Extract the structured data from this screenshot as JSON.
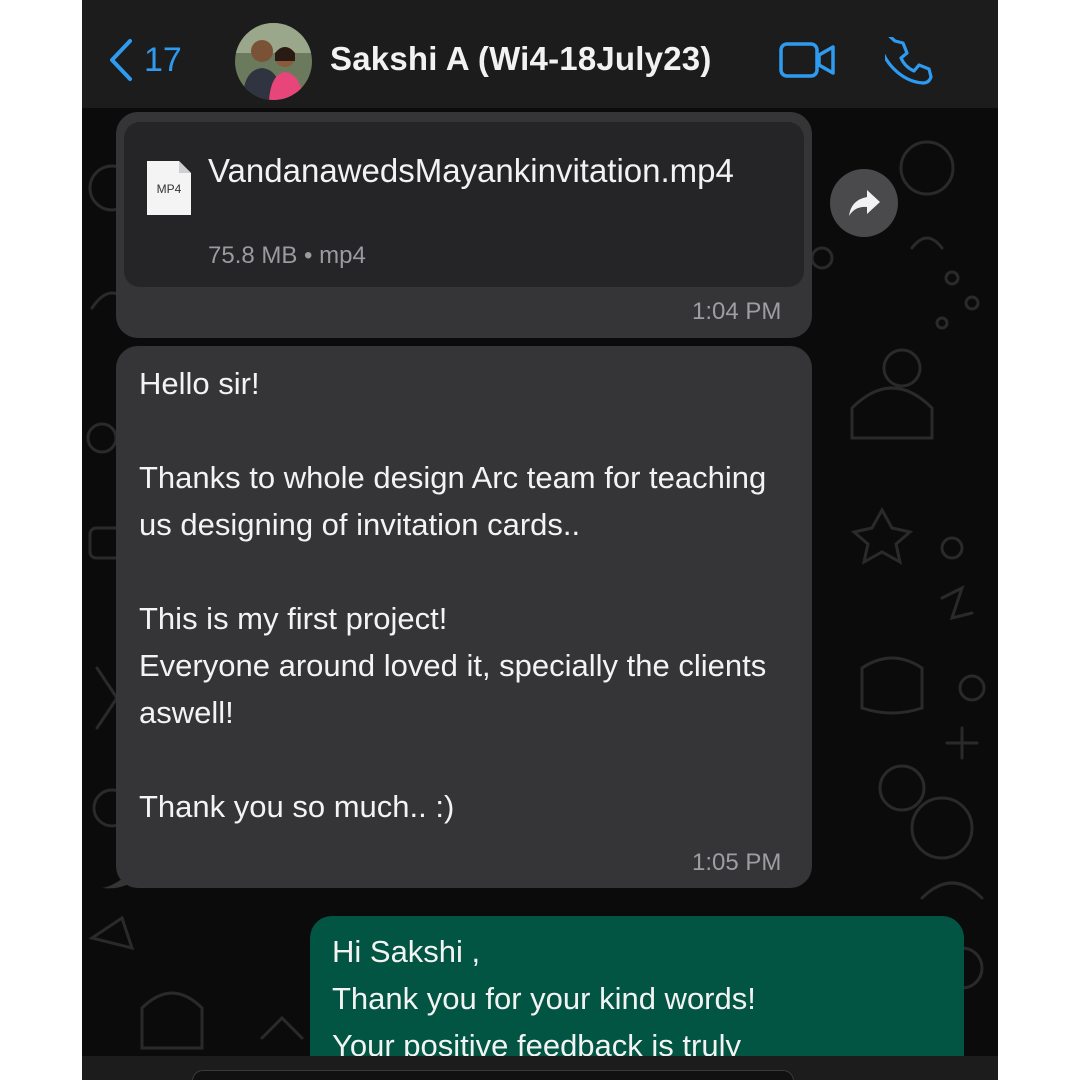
{
  "header": {
    "back_count": "17",
    "contact_name": "Sakshi A (Wi4-18July23)",
    "icons": {
      "back": "chevron-left-icon",
      "video": "video-camera-icon",
      "call": "phone-icon"
    },
    "accent_color": "#2e9bf0"
  },
  "messages": [
    {
      "type": "file",
      "direction": "incoming",
      "file_badge": "MP4",
      "file_name": "VandanawedsMayankinvitation.mp4",
      "file_meta": "75.8 MB • mp4",
      "time": "1:04 PM"
    },
    {
      "type": "text",
      "direction": "incoming",
      "text": "Hello sir!\n\nThanks to whole design Arc team for teaching us designing of invitation cards..\n\nThis is my first project!\nEveryone around loved it, specially the clients aswell!\n\nThank you so much.. :)",
      "time": "1:05 PM"
    },
    {
      "type": "text",
      "direction": "outgoing",
      "text": "Hi Sakshi ,\nThank you for your kind words!\nYour positive feedback is truly"
    }
  ],
  "colors": {
    "incoming_bubble": "#353537",
    "outgoing_bubble": "#025543",
    "background": "#0b0b0b"
  }
}
